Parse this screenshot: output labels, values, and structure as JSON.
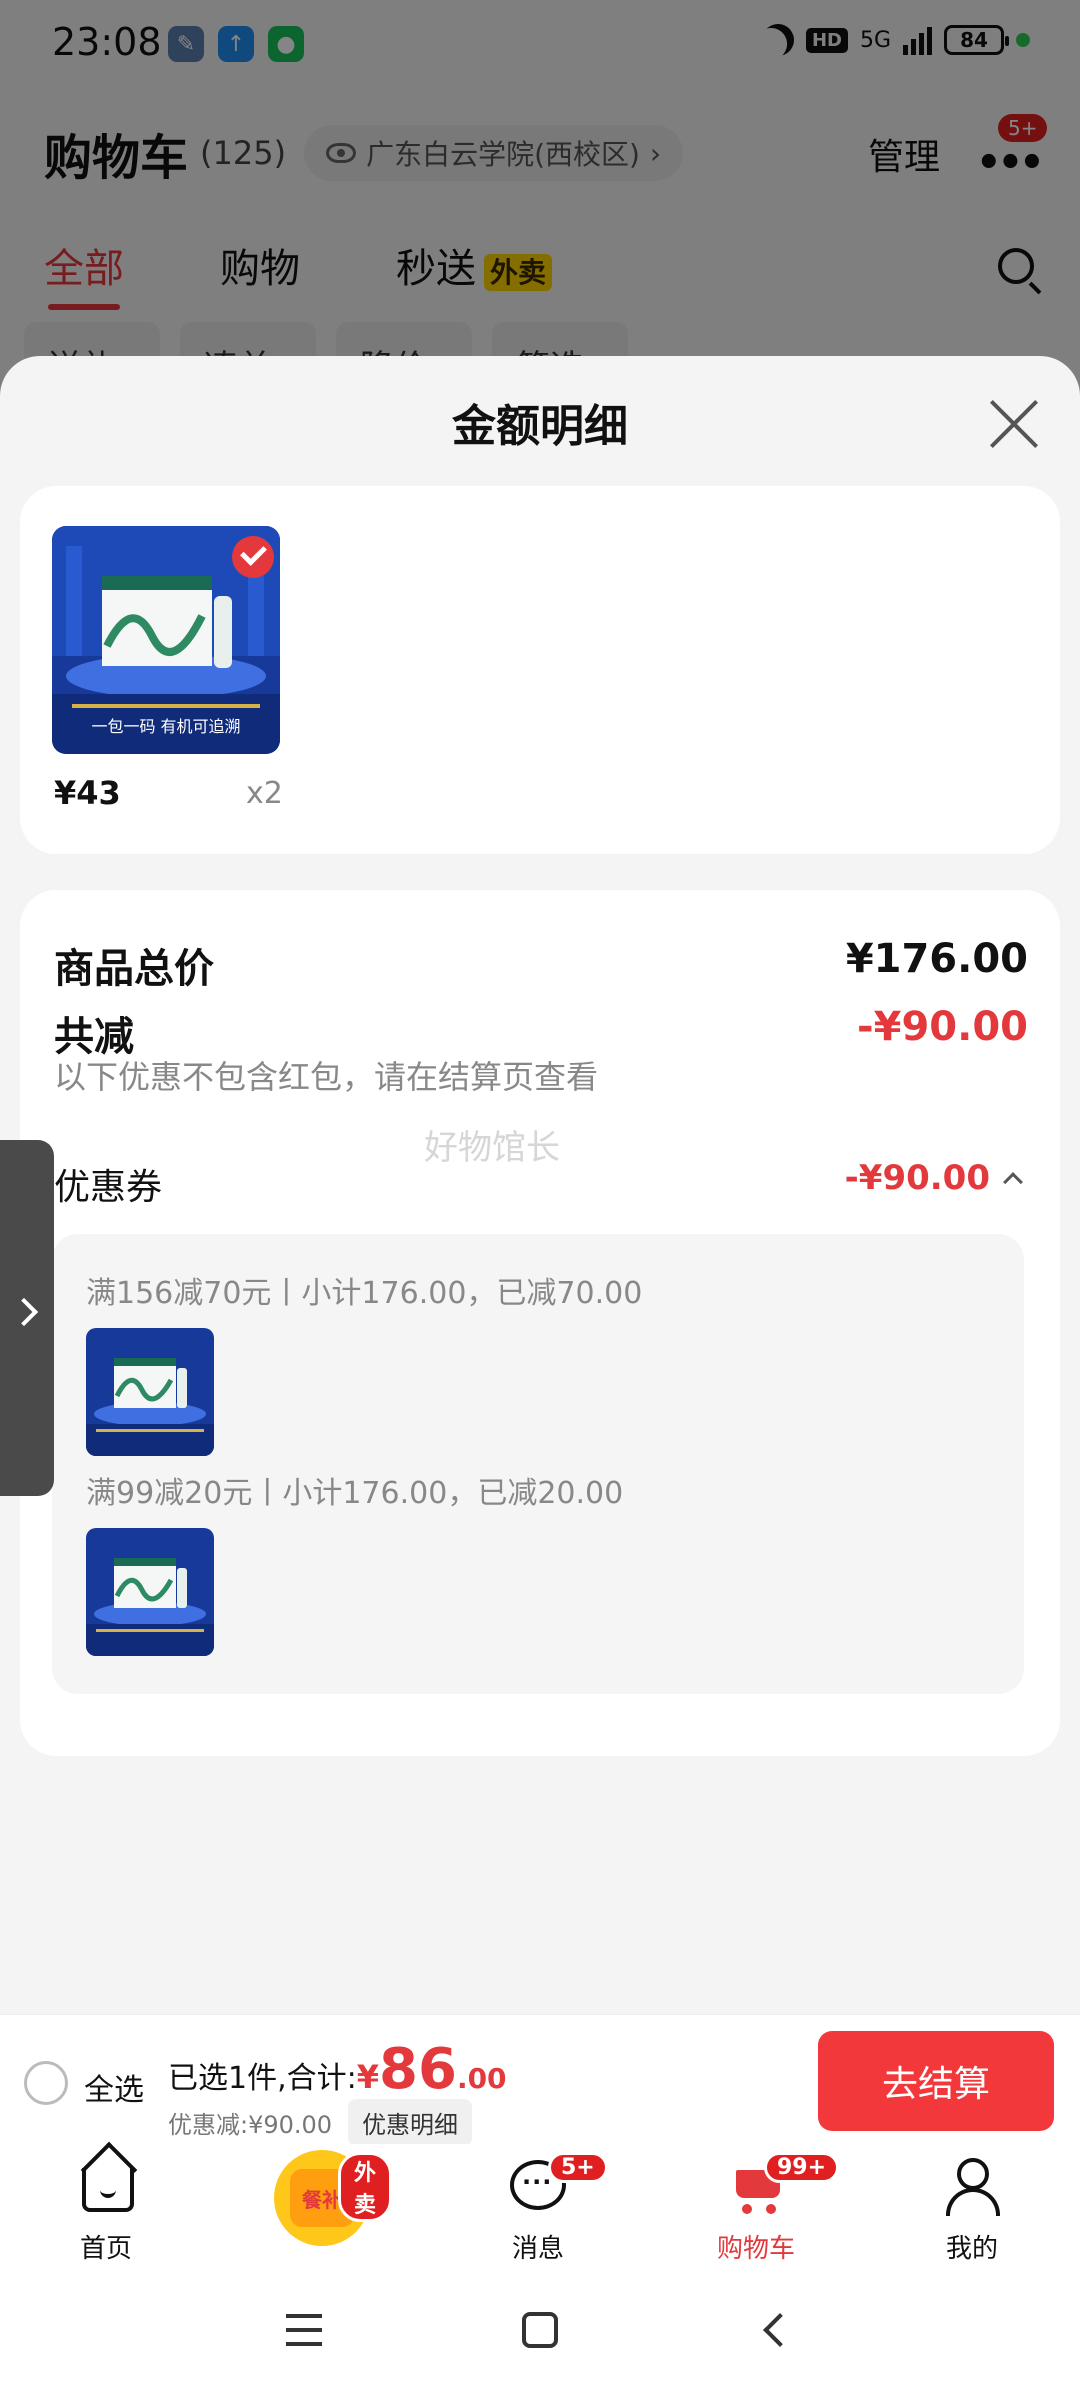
{
  "status_bar": {
    "time": "23:08",
    "hd": "HD",
    "network": "5G",
    "battery": "84"
  },
  "header": {
    "title": "购物车",
    "count": "(125)",
    "location": "广东白云学院(西校区)",
    "location_arrow": "›",
    "manage": "管理",
    "more_badge": "5+"
  },
  "tabs": [
    {
      "label": "全部"
    },
    {
      "label": "购物"
    },
    {
      "label": "秒送"
    }
  ],
  "tab_badge": "外卖",
  "filters": [
    "送礼",
    "凑单",
    "降价",
    "筛选 ▽"
  ],
  "sheet": {
    "title": "金额明细",
    "product": {
      "price": "¥43",
      "qty": "x2",
      "image_caption": "一包一码 有机可追溯"
    },
    "total_label": "商品总价",
    "total_value": "¥176.00",
    "discount_label": "共减",
    "discount_value": "-¥90.00",
    "note": "以下优惠不包含红包，请在结算页查看",
    "coupon_label": "优惠券",
    "coupon_value": "-¥90.00",
    "coupons": [
      {
        "text": "满156减70元丨小计176.00，已减70.00"
      },
      {
        "text": "满99减20元丨小计176.00，已减20.00"
      }
    ],
    "watermark": "好物馆长"
  },
  "checkout": {
    "select_all": "全选",
    "selected_text": "已选1件,合计:",
    "currency": "¥",
    "total_int": "86",
    "total_dec": ".00",
    "discount_text": "优惠减:¥90.00",
    "detail_button": "优惠明细",
    "checkout_button": "去结算"
  },
  "bottom_nav": [
    {
      "label": "首页"
    },
    {
      "label": "",
      "badge": "外卖",
      "icon_text": "餐补"
    },
    {
      "label": "消息",
      "badge": "5+"
    },
    {
      "label": "购物车",
      "badge": "99+"
    },
    {
      "label": "我的"
    }
  ],
  "colors": {
    "accent": "#e4393c",
    "badge": "#ffd400",
    "checkout_button": "#f2383a"
  }
}
